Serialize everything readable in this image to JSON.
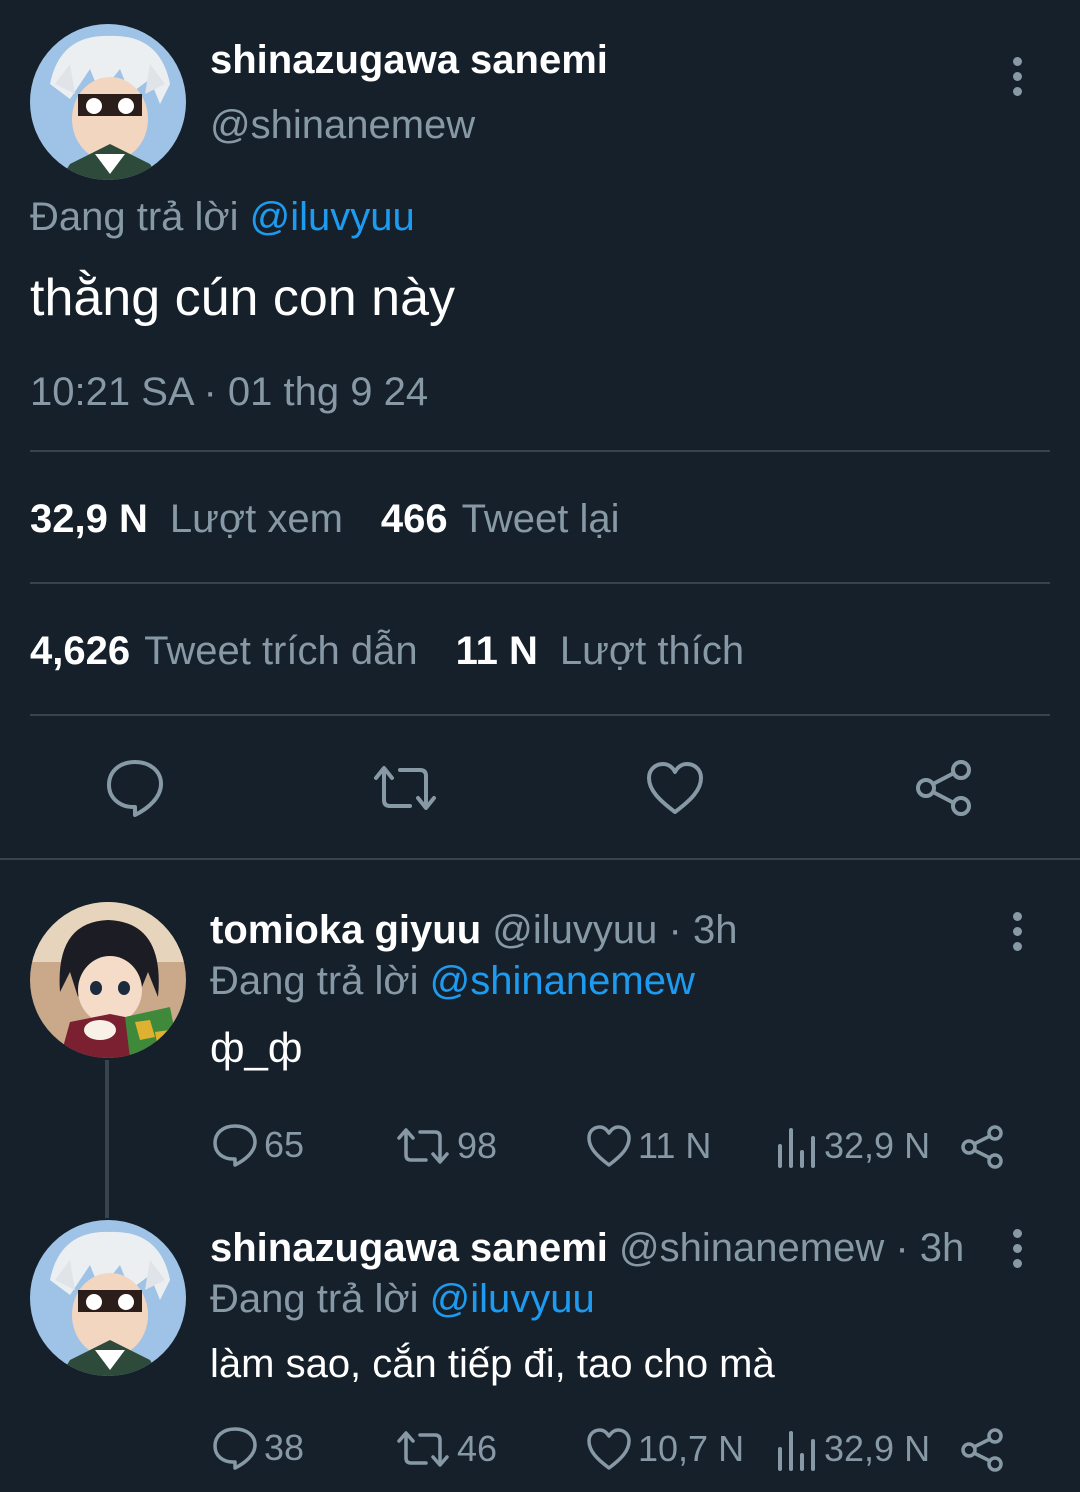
{
  "main_tweet": {
    "display_name": "shinazugawa sanemi",
    "handle": "@shinanemew",
    "reply_prefix": "Đang trả lời",
    "reply_to": "@iluvyuu",
    "text": "thằng cún con này",
    "timestamp": "10:21 SA · 01 thg 9 24",
    "stats": {
      "views_num": "32,9 N",
      "views_label": "Lượt xem",
      "retweets_num": "466",
      "retweets_label": "Tweet lại",
      "quotes_num": "4,626",
      "quotes_label": "Tweet trích dẫn",
      "likes_num": "11 N",
      "likes_label": "Lượt thích"
    }
  },
  "replies": [
    {
      "display_name": "tomioka giyuu",
      "handle": "@iluvyuu",
      "time": "· 3h",
      "reply_prefix": "Đang trả lời",
      "reply_to": "@shinanemew",
      "text": "ф_ф",
      "replies": "65",
      "retweets": "98",
      "likes": "11 N",
      "views": "32,9 N"
    },
    {
      "display_name": "shinazugawa sanemi",
      "handle": "@shinanemew",
      "time": "· 3h",
      "reply_prefix": "Đang trả lời",
      "reply_to": "@iluvyuu",
      "text": "làm sao, cắn tiếp đi, tao cho mà",
      "replies": "38",
      "retweets": "46",
      "likes": "10,7 N",
      "views": "32,9 N"
    }
  ],
  "colors": {
    "background": "#15202b",
    "accent": "#1d9bf0",
    "muted": "#8899a6",
    "divider": "#38444d"
  }
}
